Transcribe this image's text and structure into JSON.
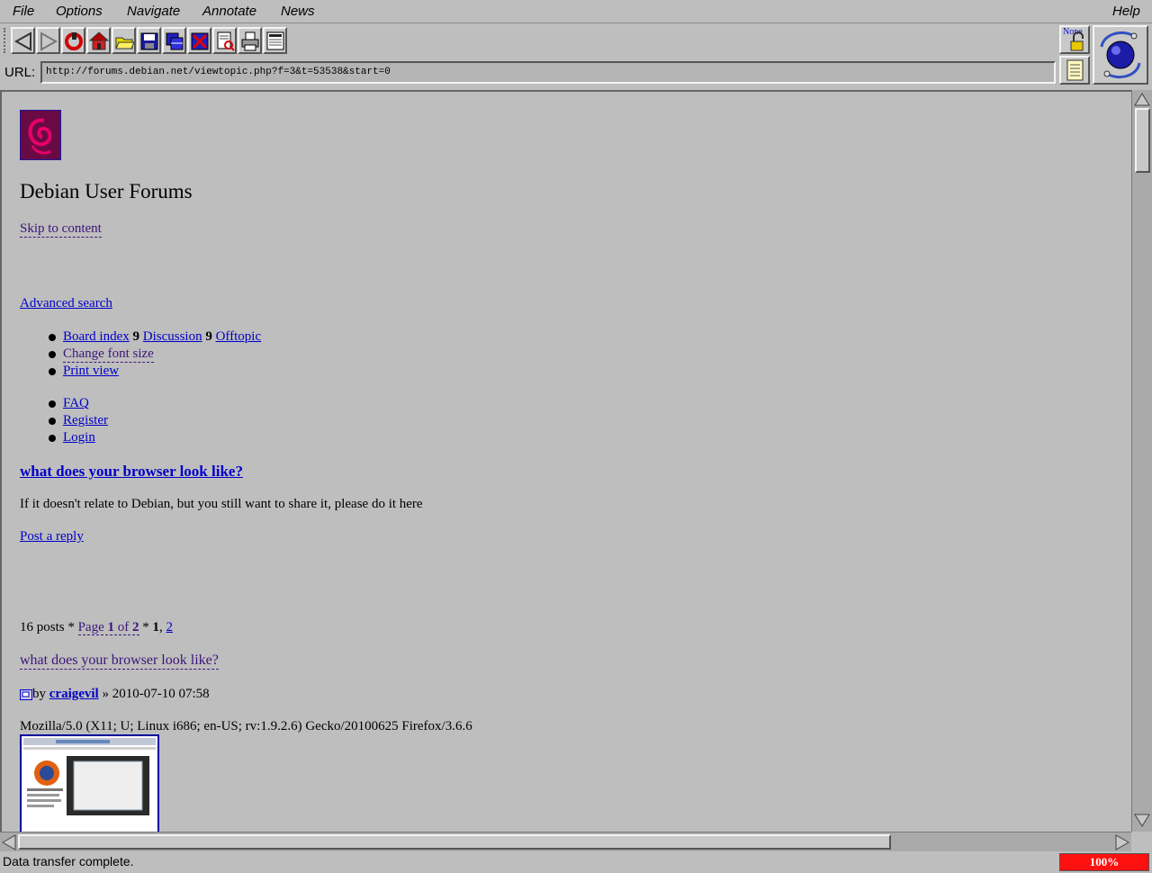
{
  "menubar": {
    "file": "File",
    "options": "Options",
    "navigate": "Navigate",
    "annotate": "Annotate",
    "news": "News",
    "help": "Help"
  },
  "toolbar": {
    "security_label": "None"
  },
  "url_bar": {
    "label": "URL:",
    "value": "http://forums.debian.net/viewtopic.php?f=3&t=53538&start=0"
  },
  "page": {
    "site_title": "Debian User Forums",
    "skip_link": "Skip to content",
    "advanced_search": "Advanced search",
    "breadcrumbs": [
      "Board index",
      "Discussion",
      "Offtopic"
    ],
    "breadcrumb_sep": "9",
    "change_font_size": "Change font size",
    "print_view": "Print view",
    "user_links": [
      "FAQ",
      "Register",
      "Login"
    ],
    "topic_title": "what does your browser look like?",
    "forum_description": "If it doesn't relate to Debian, but you still want to share it, please do it here",
    "post_reply": "Post a reply",
    "pagination": {
      "posts": "16 posts",
      "sep1": "*",
      "page_word": "Page",
      "current": "1",
      "of_word": "of",
      "total": "2",
      "sep2": "*",
      "page1": "1",
      "comma": ",",
      "page2": "2"
    },
    "post": {
      "title": "what does your browser look like?",
      "by": "by",
      "author": "craigevil",
      "date_sep": "»",
      "date": "2010-07-10 07:58",
      "body": "Mozilla/5.0 (X11; U; Linux i686; en-US; rv:1.9.2.6) Gecko/20100625 Firefox/3.6.6"
    }
  },
  "status": {
    "text": "Data transfer complete.",
    "progress": "100%"
  },
  "colors": {
    "link": "#0000c8",
    "visited_link": "#3c1478",
    "progress_fill": "#ff1010",
    "debian_swirl": "#c8005a"
  }
}
